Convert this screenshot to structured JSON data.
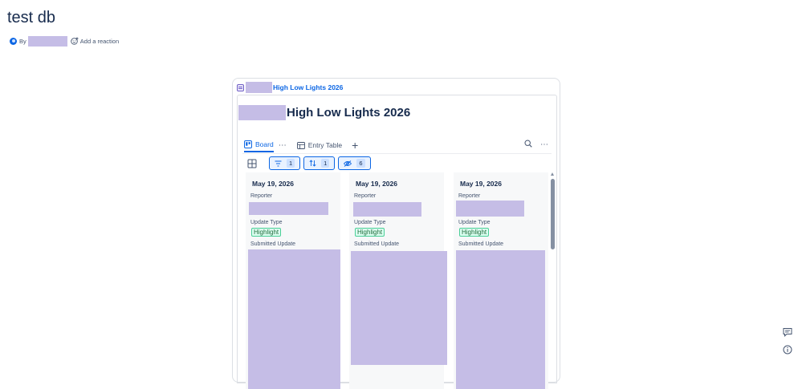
{
  "page": {
    "title": "test db",
    "byline_prefix": "By",
    "add_reaction_label": "Add a reaction"
  },
  "embed": {
    "link_title": "High Low Lights 2026",
    "database_title": "High Low Lights 2026"
  },
  "views": {
    "tabs": [
      {
        "label": "Board",
        "icon": "board-icon",
        "active": true
      },
      {
        "label": "Entry Table",
        "icon": "table-icon",
        "active": false
      }
    ]
  },
  "toolbar": {
    "filter_count": "1",
    "sort_count": "1",
    "hidden_count": "6"
  },
  "columns": [
    {
      "date": "May 19, 2026",
      "reporter_label": "Reporter",
      "update_type_label": "Update Type",
      "update_type": "Highlight",
      "submitted_label": "Submitted Update"
    },
    {
      "date": "May 19, 2026",
      "reporter_label": "Reporter",
      "update_type_label": "Update Type",
      "update_type": "Highlight",
      "submitted_label": "Submitted Update"
    },
    {
      "date": "May 19, 2026",
      "reporter_label": "Reporter",
      "update_type_label": "Update Type",
      "update_type": "Highlight",
      "submitted_label": "Submitted Update"
    }
  ],
  "colors": {
    "accent": "#0c66e4",
    "redaction": "#c5bde6",
    "badge_green": "#dcfff1"
  }
}
